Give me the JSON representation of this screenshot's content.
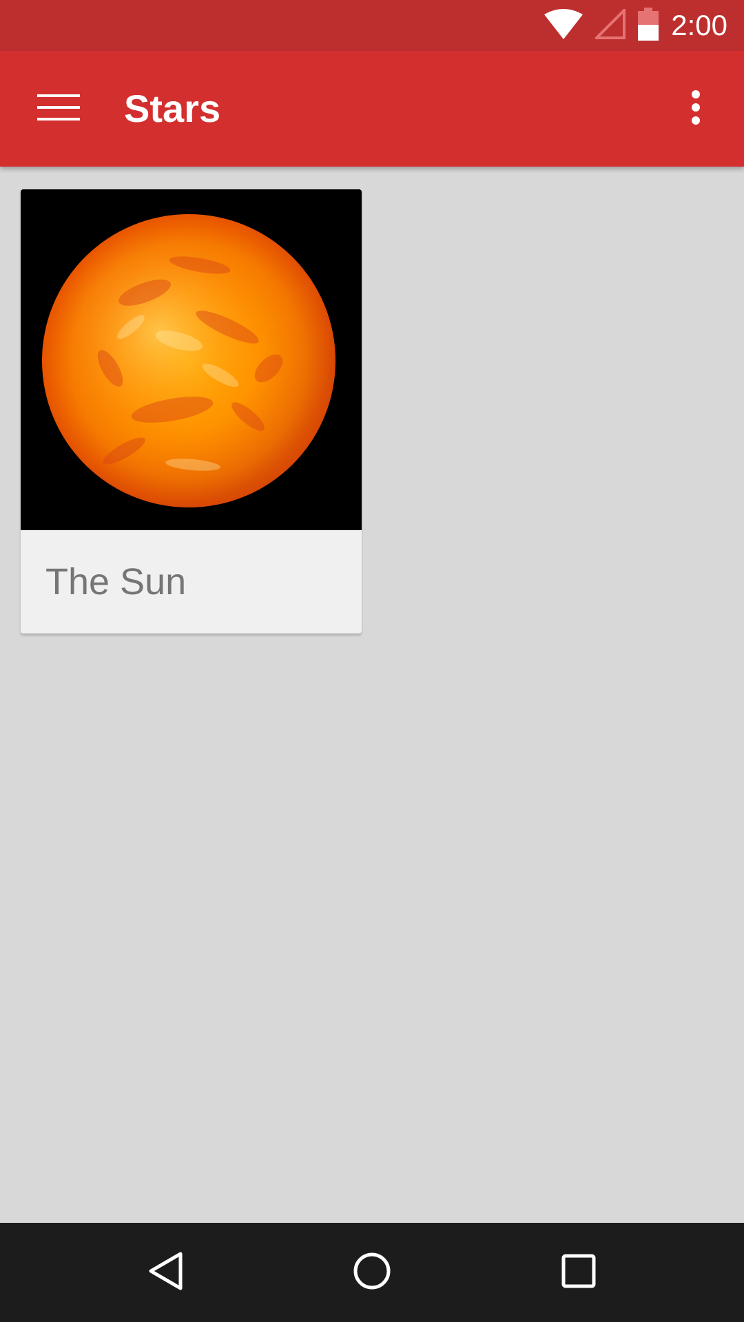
{
  "status_bar": {
    "time": "2:00",
    "icons": [
      "wifi-icon",
      "cell-signal-icon",
      "battery-icon"
    ],
    "background_color": "#bd2f2f"
  },
  "app_bar": {
    "title": "Stars",
    "menu_icon": "menu-icon",
    "overflow_icon": "more-vert-icon",
    "background_color": "#d32f2f"
  },
  "cards": [
    {
      "label": "The Sun",
      "image": "sun-image"
    }
  ],
  "nav_bar": {
    "buttons": [
      "back-icon",
      "home-icon",
      "recents-icon"
    ],
    "background_color": "#1c1c1c"
  }
}
